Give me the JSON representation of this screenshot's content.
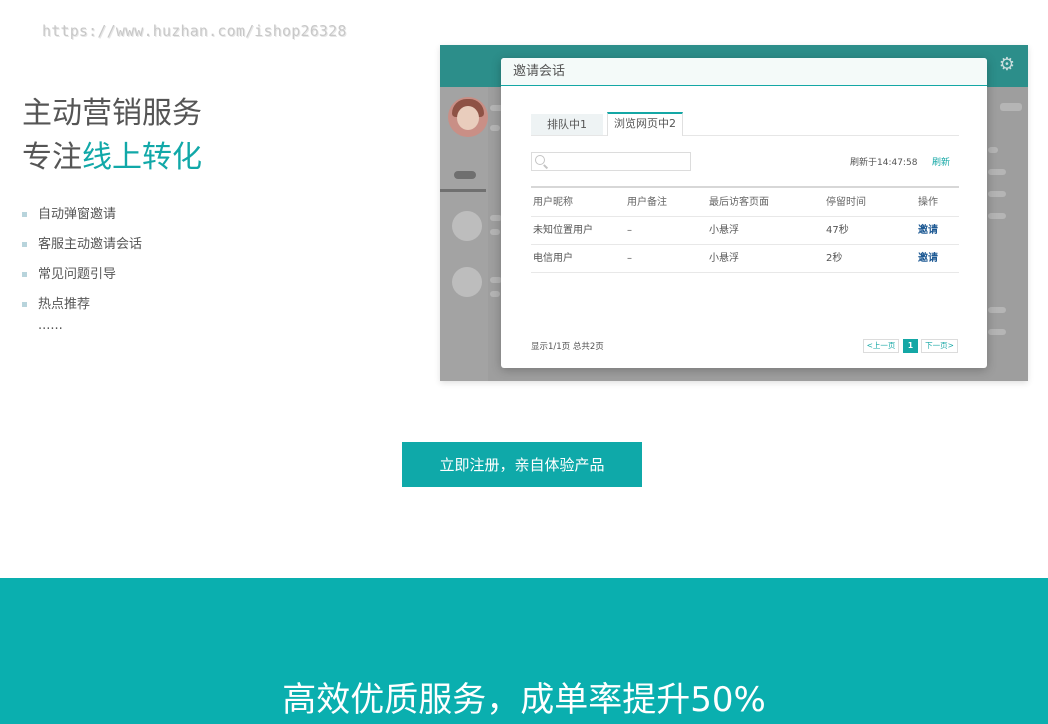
{
  "watermark": "https://www.huzhan.com/ishop26328",
  "promo": {
    "title_line1": "主动营销服务",
    "title_line2_prefix": "专注",
    "title_line2_accent": "线上转化",
    "features": [
      "自动弹窗邀请",
      "客服主动邀请会话",
      "常见问题引导",
      "热点推荐"
    ],
    "more": "......"
  },
  "modal": {
    "title": "邀请会话",
    "tabs": [
      {
        "label": "排队中1",
        "active": false
      },
      {
        "label": "浏览网页中2",
        "active": true
      }
    ],
    "search": {
      "placeholder": "",
      "value": ""
    },
    "refresh_time": "刷新于14:47:58",
    "refresh_label": "刷新",
    "table": {
      "columns": [
        "用户昵称",
        "用户备注",
        "最后访客页面",
        "停留时间",
        "操作"
      ],
      "rows": [
        [
          "未知位置用户",
          "–",
          "小悬浮",
          "47秒",
          "邀请"
        ],
        [
          "电信用户",
          "–",
          "小悬浮",
          "2秒",
          "邀请"
        ]
      ]
    },
    "page_summary": "显示1/1页 总共2页",
    "pager": {
      "prev": "<上一页",
      "current": "1",
      "next": "下一页>"
    }
  },
  "cta": {
    "label": "立即注册，亲自体验产品"
  },
  "band": {
    "title": "高效优质服务，成单率提升50%"
  },
  "colors": {
    "accent": "#0fa9a9",
    "topbar": "#2c8e8a",
    "link": "#1e5a94"
  },
  "icons": {
    "settings": "gear-icon",
    "search": "search-icon"
  }
}
